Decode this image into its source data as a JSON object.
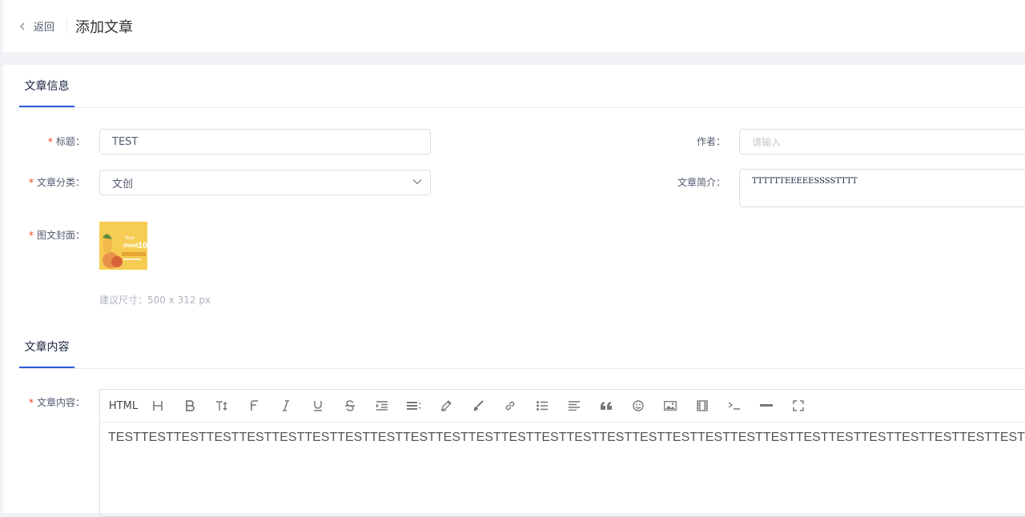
{
  "header": {
    "back_label": "返回",
    "title": "添加文章"
  },
  "sections": {
    "info_tab": "文章信息",
    "content_tab": "文章内容"
  },
  "form": {
    "title_label": "标题：",
    "title_value": "TEST",
    "author_label": "作者：",
    "author_placeholder": "请输入",
    "category_label": "文章分类：",
    "category_value": "文创",
    "summary_label": "文章简介：",
    "summary_value": "TTTTTTEEEEESSSSTTTT",
    "cover_label": "图文封面：",
    "cover_hint": "建议尺寸：500 x 312 px",
    "content_label": "文章内容："
  },
  "editor": {
    "html_label": "HTML",
    "content": "TESTTESTTESTTESTTESTTESTTESTTESTTESTTESTTESTTESTTESTTESTTESTTESTTESTTESTTESTTESTTESTTESTTESTTESTTESTTESTTESTTEST"
  },
  "colors": {
    "accent": "#2d5bdd",
    "required": "#ed4014"
  }
}
